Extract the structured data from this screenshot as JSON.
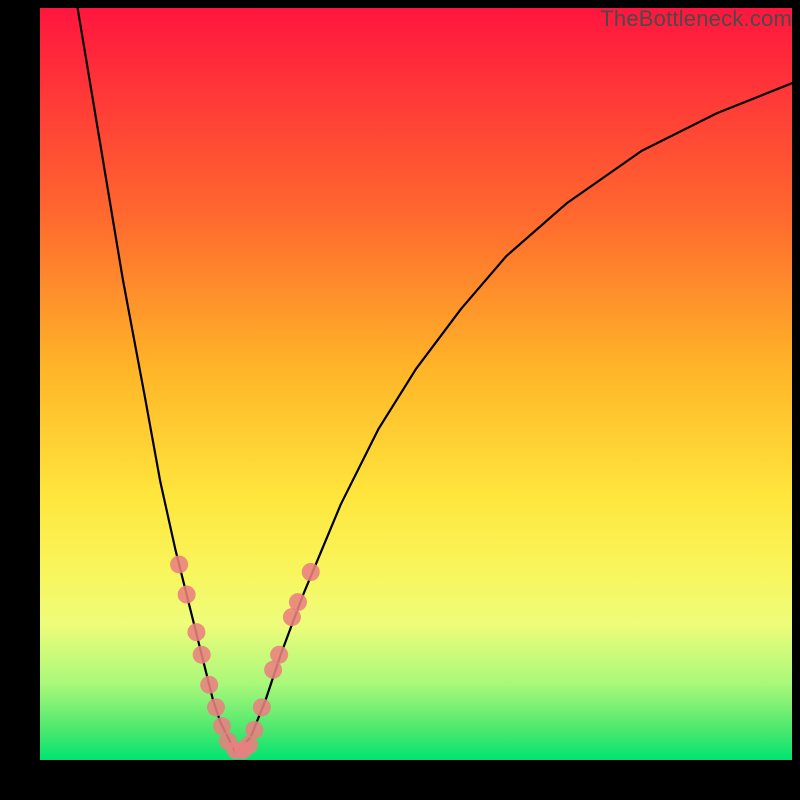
{
  "watermark": "TheBottleneck.com",
  "colors": {
    "curve_stroke": "#000000",
    "marker_fill": "#e98080",
    "background_black": "#000000"
  },
  "chart_data": {
    "type": "line",
    "title": "",
    "xlabel": "",
    "ylabel": "",
    "xlim": [
      0,
      100
    ],
    "ylim": [
      0,
      100
    ],
    "grid": false,
    "legend": false,
    "series": [
      {
        "name": "left-branch",
        "x": [
          5,
          8,
          11,
          14,
          16,
          18,
          20,
          21,
          22,
          23,
          24,
          25,
          26
        ],
        "y": [
          100,
          82,
          64,
          48,
          37,
          28,
          20,
          16,
          12,
          8,
          5,
          3,
          1
        ]
      },
      {
        "name": "right-branch",
        "x": [
          26,
          28,
          30,
          32,
          35,
          40,
          45,
          50,
          56,
          62,
          70,
          80,
          90,
          100
        ],
        "y": [
          1,
          3,
          8,
          14,
          22,
          34,
          44,
          52,
          60,
          67,
          74,
          81,
          86,
          90
        ]
      }
    ],
    "markers": {
      "name": "highlighted-points",
      "points": [
        {
          "x": 18.5,
          "y": 26
        },
        {
          "x": 19.5,
          "y": 22
        },
        {
          "x": 20.8,
          "y": 17
        },
        {
          "x": 21.5,
          "y": 14
        },
        {
          "x": 22.5,
          "y": 10
        },
        {
          "x": 23.4,
          "y": 7
        },
        {
          "x": 24.2,
          "y": 4.5
        },
        {
          "x": 25.0,
          "y": 2.5
        },
        {
          "x": 26.0,
          "y": 1.3
        },
        {
          "x": 27.0,
          "y": 1.3
        },
        {
          "x": 27.8,
          "y": 2.0
        },
        {
          "x": 28.5,
          "y": 4.0
        },
        {
          "x": 29.5,
          "y": 7.0
        },
        {
          "x": 31.0,
          "y": 12.0
        },
        {
          "x": 31.8,
          "y": 14.0
        },
        {
          "x": 33.5,
          "y": 19.0
        },
        {
          "x": 34.3,
          "y": 21.0
        },
        {
          "x": 36.0,
          "y": 25.0
        }
      ]
    }
  }
}
